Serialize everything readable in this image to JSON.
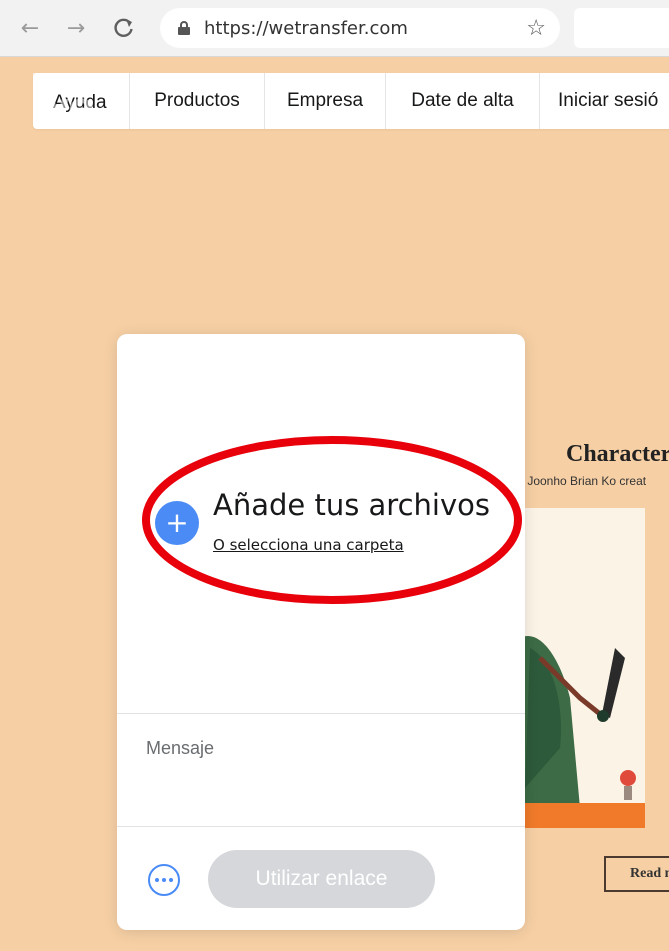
{
  "browser": {
    "url": "https://wetransfer.com"
  },
  "nav": {
    "items": [
      {
        "label": "Ayuda"
      },
      {
        "label": "Productos"
      },
      {
        "label": "Empresa"
      },
      {
        "label": "Date de alta"
      },
      {
        "label": "Iniciar sesió"
      }
    ]
  },
  "brand": {
    "logo_text": "we"
  },
  "ad": {
    "title": "Character-",
    "subtitle": "r Joonho Brian Ko creat",
    "button": "Read m"
  },
  "upload": {
    "title": "Añade tus archivos",
    "folder_link": "O selecciona una carpeta",
    "message_placeholder": "Mensaje",
    "action_label": "Utilizar enlace"
  },
  "colors": {
    "background": "#f6cfa4",
    "accent": "#4a8bf5",
    "annotation": "#e8000b",
    "disabled_button": "#d5d7da"
  }
}
